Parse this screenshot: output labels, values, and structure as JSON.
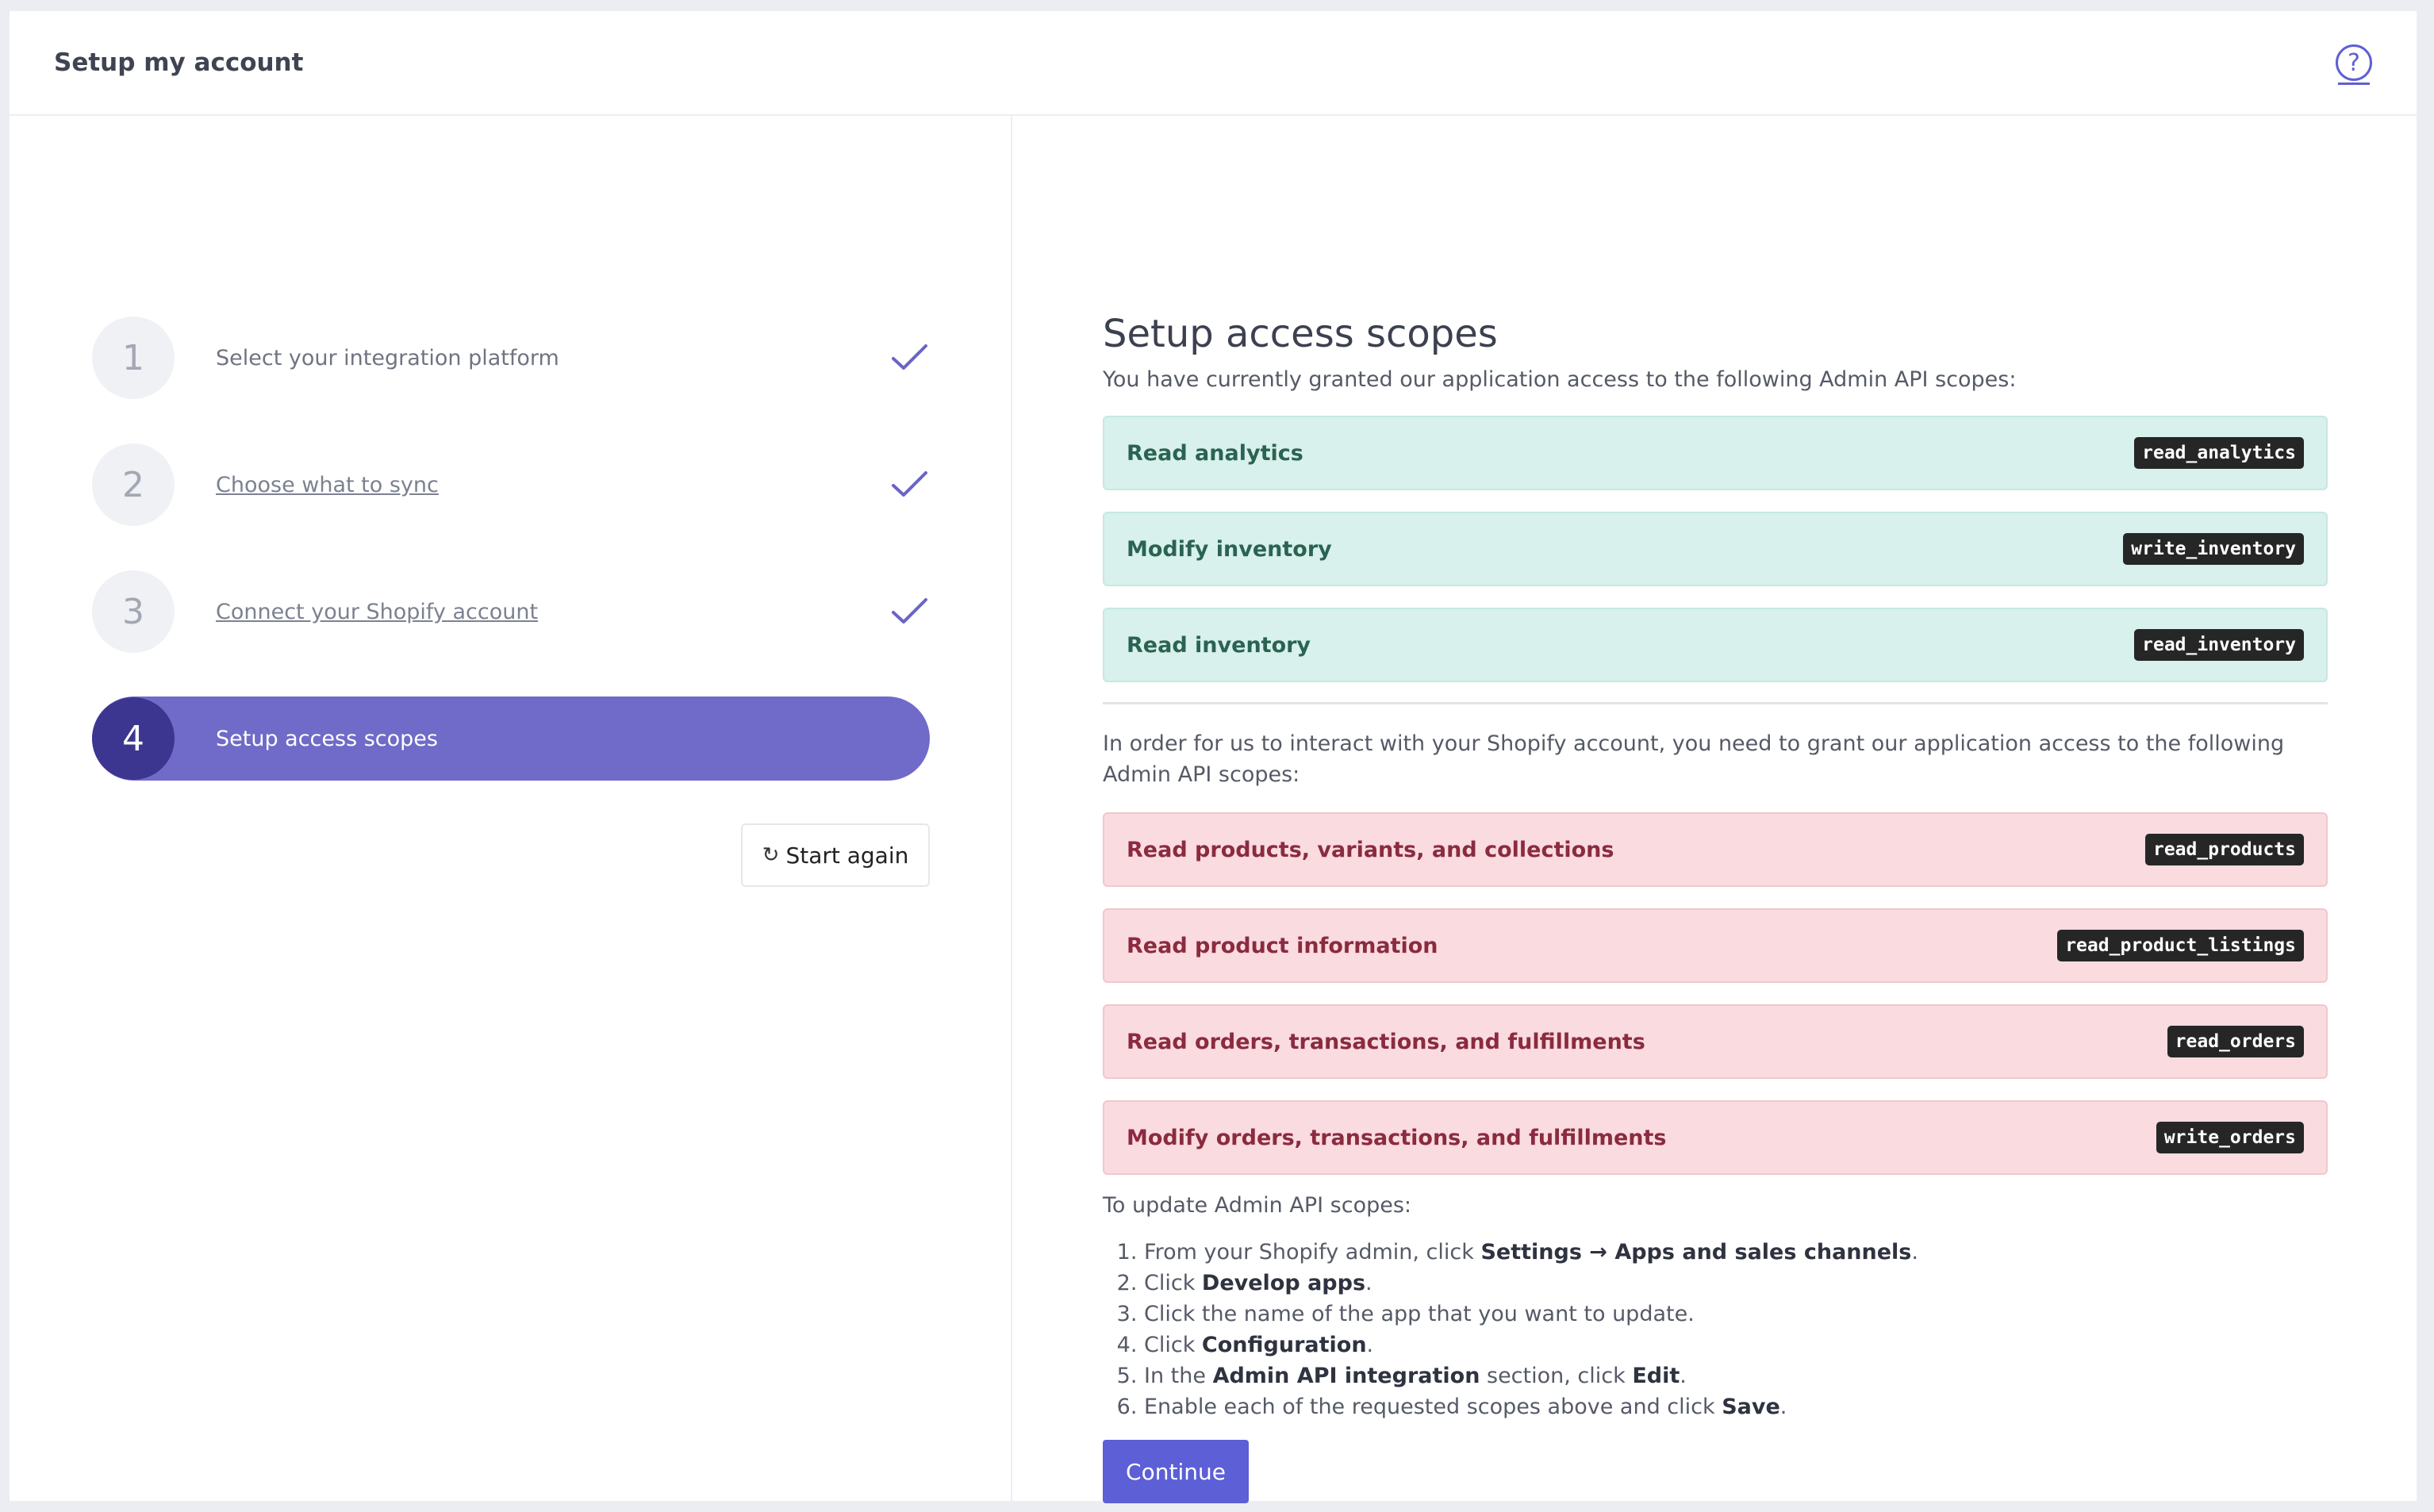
{
  "header": {
    "title": "Setup my account",
    "help_icon": "question-circle-icon",
    "help_glyph": "?"
  },
  "steps": [
    {
      "number": "1",
      "label": "Select your integration platform",
      "status": "complete"
    },
    {
      "number": "2",
      "label": "Choose what to sync",
      "status": "complete"
    },
    {
      "number": "3",
      "label": "Connect your Shopify account",
      "status": "complete"
    },
    {
      "number": "4",
      "label": "Setup access scopes",
      "status": "active"
    }
  ],
  "start_again": {
    "label": "Start again",
    "icon": "refresh-icon",
    "glyph": "↻"
  },
  "main": {
    "title": "Setup access scopes",
    "granted_intro": "You have currently granted our application access to the following Admin API scopes:",
    "granted_scopes": [
      {
        "name": "Read analytics",
        "code": "read_analytics"
      },
      {
        "name": "Modify inventory",
        "code": "write_inventory"
      },
      {
        "name": "Read inventory",
        "code": "read_inventory"
      }
    ],
    "needed_intro": "In order for us to interact with your Shopify account, you need to grant our application access to the following Admin API scopes:",
    "needed_scopes": [
      {
        "name": "Read products, variants, and collections",
        "code": "read_products"
      },
      {
        "name": "Read product information",
        "code": "read_product_listings"
      },
      {
        "name": "Read orders, transactions, and fulfillments",
        "code": "read_orders"
      },
      {
        "name": "Modify orders, transactions, and fulfillments",
        "code": "write_orders"
      }
    ],
    "update_title": "To update Admin API scopes:",
    "instructions": {
      "s1_pre": "From your Shopify admin, click ",
      "s1_bold": "Settings → Apps and sales channels",
      "s1_post": ".",
      "s2_pre": "Click ",
      "s2_bold": "Develop apps",
      "s2_post": ".",
      "s3": "Click the name of the app that you want to update.",
      "s4_pre": "Click ",
      "s4_bold": "Configuration",
      "s4_post": ".",
      "s5_pre": "In the ",
      "s5_bold": "Admin API integration",
      "s5_mid": " section, click ",
      "s5_bold2": "Edit",
      "s5_post": ".",
      "s6_pre": "Enable each of the requested scopes above and click ",
      "s6_bold": "Save",
      "s6_post": "."
    },
    "continue_label": "Continue"
  },
  "colors": {
    "accent": "#5c5fd6",
    "active_step": "#706ac8",
    "granted_bg": "#d8f1ec",
    "needed_bg": "#fadbe0"
  }
}
